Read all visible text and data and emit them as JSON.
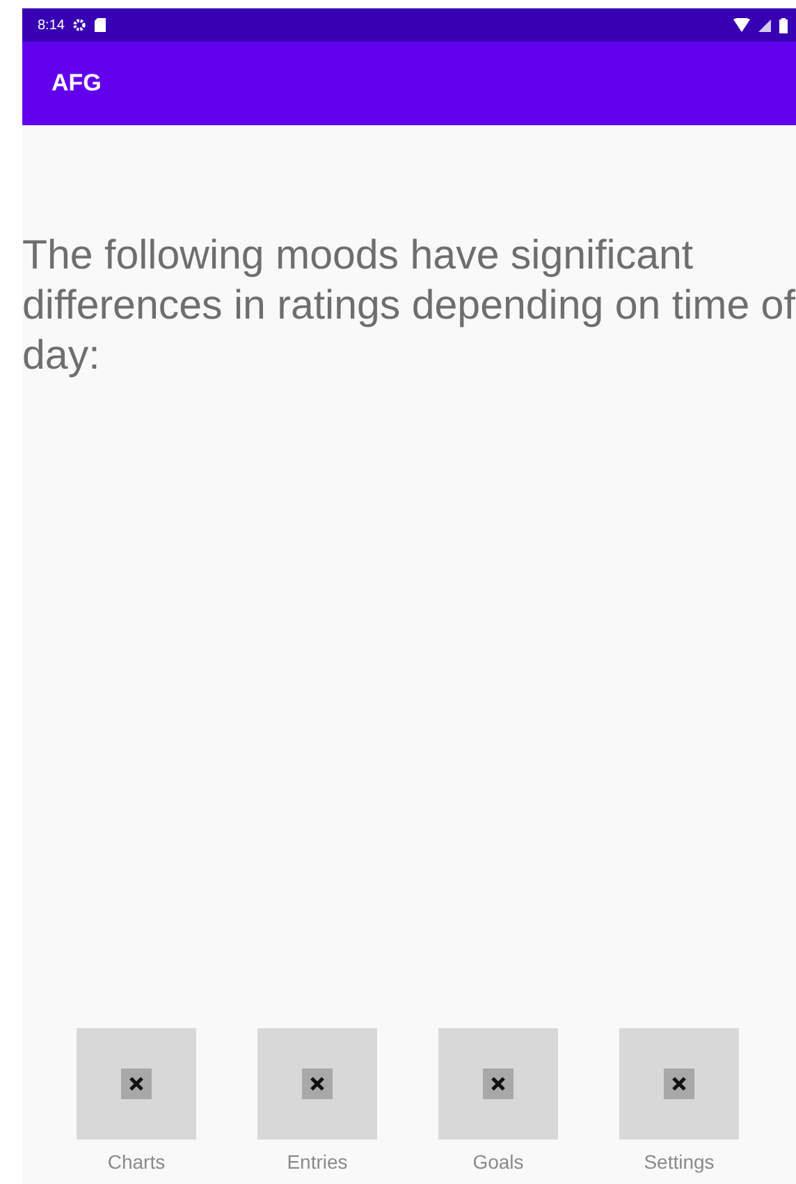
{
  "status_bar": {
    "time": "8:14"
  },
  "app_bar": {
    "title": "AFG"
  },
  "message": "The following moods have significant differences in ratings depending on time of day:",
  "nav_items": [
    {
      "label": "Charts"
    },
    {
      "label": "Entries"
    },
    {
      "label": "Goals"
    },
    {
      "label": "Settings"
    }
  ]
}
